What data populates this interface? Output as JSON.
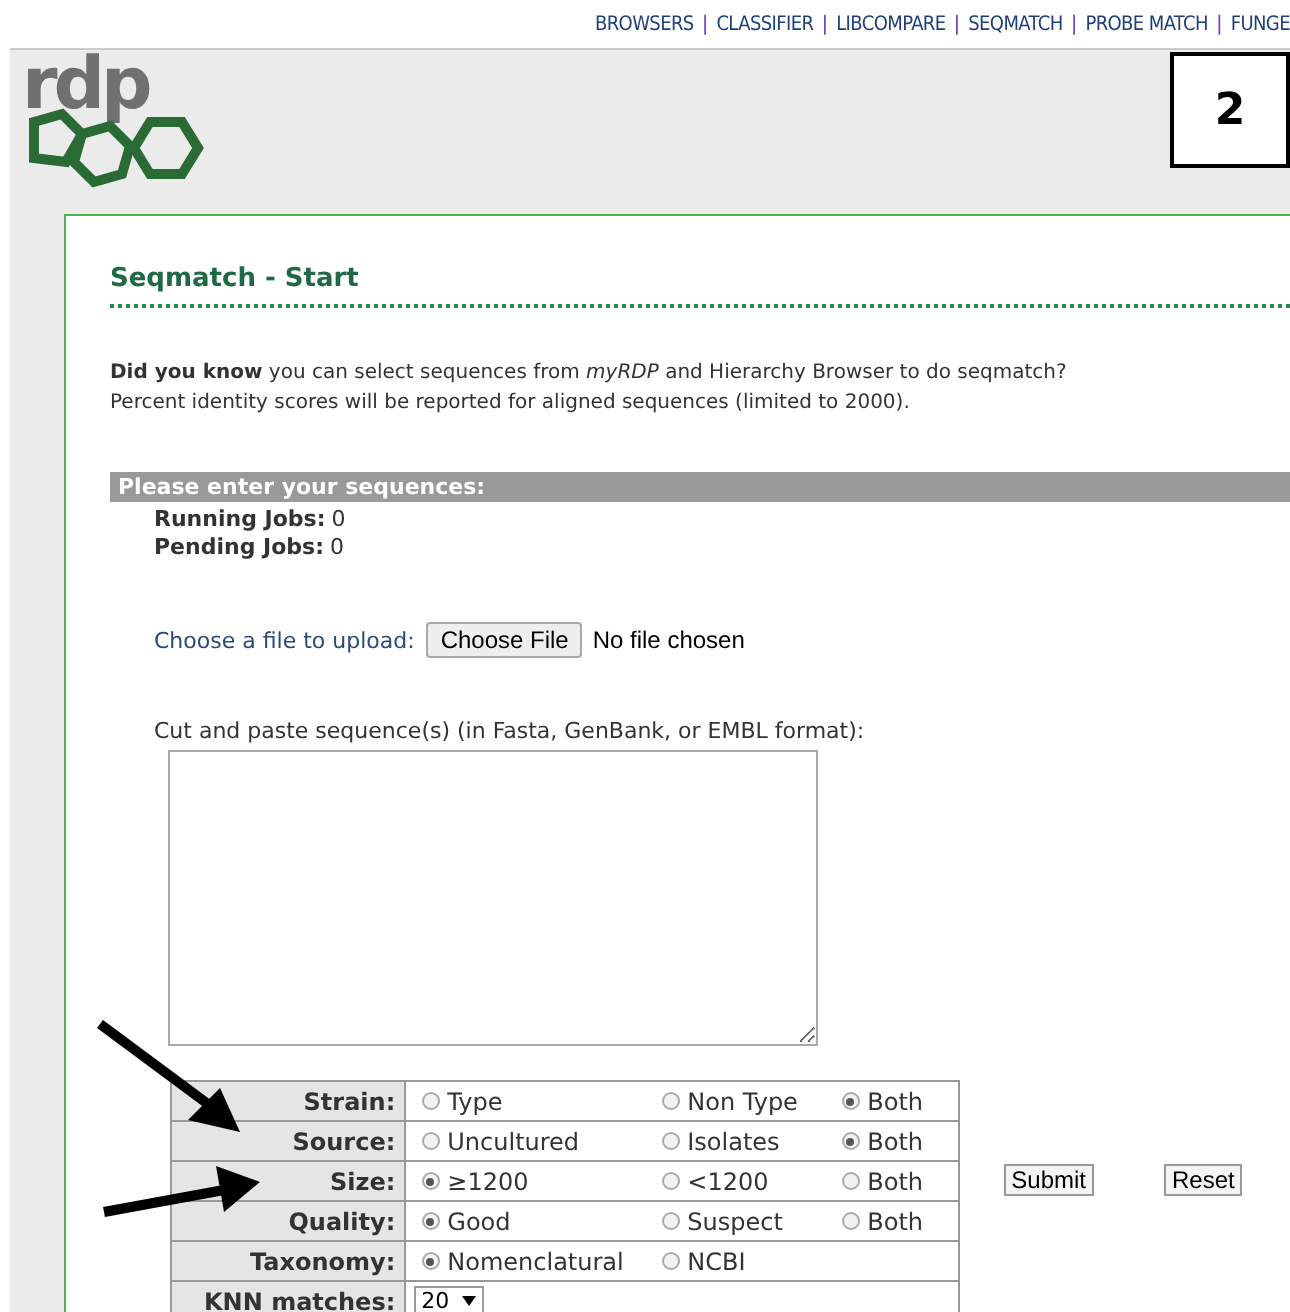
{
  "top_nav": [
    {
      "kind": "link",
      "label": "BROWSERS"
    },
    {
      "kind": "separator",
      "label": "|"
    },
    {
      "kind": "link",
      "label": "CLASSIFIER"
    },
    {
      "kind": "separator",
      "label": "|"
    },
    {
      "kind": "link",
      "label": "LIBCOMPARE"
    },
    {
      "kind": "separator",
      "label": "|"
    },
    {
      "kind": "link",
      "label": "SEQMATCH"
    },
    {
      "kind": "separator",
      "label": "|"
    },
    {
      "kind": "link",
      "label": "PROBE MATCH"
    },
    {
      "kind": "separator",
      "label": "|"
    },
    {
      "kind": "link",
      "label": "FUNGE"
    }
  ],
  "logo": {
    "text": "rdp"
  },
  "step_badge": "2",
  "title": "Seqmatch - Start",
  "info": [
    "**Did you know** you can select sequences from *myRDP* and Hierarchy Browser to do seqmatch?",
    "Percent identity scores will be reported for aligned sequences (limited to 2000)."
  ],
  "section_header": "Please enter your sequences:",
  "jobs": [
    {
      "label": "Running Jobs:",
      "value": "0"
    },
    {
      "label": "Pending Jobs:",
      "value": "0"
    }
  ],
  "upload": {
    "label": "Choose a file to upload:",
    "button": "Choose File",
    "status": "No file chosen"
  },
  "paste_label": "Cut and paste sequence(s) (in Fasta, GenBank, or EMBL format):",
  "options": [
    {
      "kind": "radio",
      "label": "Strain:",
      "choices": [
        {
          "label": "Type",
          "selected": false
        },
        {
          "label": "Non Type",
          "selected": false
        },
        {
          "label": "Both",
          "selected": true
        }
      ]
    },
    {
      "kind": "radio",
      "label": "Source:",
      "choices": [
        {
          "label": "Uncultured",
          "selected": false
        },
        {
          "label": "Isolates",
          "selected": false
        },
        {
          "label": "Both",
          "selected": true
        }
      ]
    },
    {
      "kind": "radio",
      "label": "Size:",
      "choices": [
        {
          "label": "≥1200",
          "selected": true
        },
        {
          "label": "<1200",
          "selected": false
        },
        {
          "label": "Both",
          "selected": false
        }
      ]
    },
    {
      "kind": "radio",
      "label": "Quality:",
      "choices": [
        {
          "label": "Good",
          "selected": true
        },
        {
          "label": "Suspect",
          "selected": false
        },
        {
          "label": "Both",
          "selected": false
        }
      ]
    },
    {
      "kind": "radio",
      "label": "Taxonomy:",
      "choices": [
        {
          "label": "Nomenclatural",
          "selected": true
        },
        {
          "label": "NCBI",
          "selected": false
        }
      ]
    },
    {
      "kind": "select",
      "label": "KNN matches:",
      "value": "20"
    }
  ],
  "buttons": [
    "Submit",
    "Reset"
  ]
}
